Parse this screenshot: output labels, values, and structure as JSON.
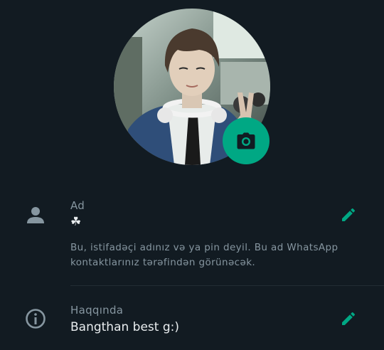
{
  "profile_photo": {
    "alt": "profile photo",
    "camera_icon": "camera-icon"
  },
  "name_section": {
    "icon": "person-icon",
    "label": "Ad",
    "value": "☘︎",
    "edit_icon": "pencil-icon",
    "hint": "Bu, istifadəçi adınız və ya pin deyil. Bu ad WhatsApp kontaktlarınız tərəfindən görünəcək."
  },
  "about_section": {
    "icon": "info-icon",
    "label": "Haqqında",
    "value": "Bangthan best g:)",
    "edit_icon": "pencil-icon"
  },
  "colors": {
    "background": "#121b22",
    "accent": "#00a884",
    "icon": "#8696a0",
    "text_primary": "#e9edef",
    "text_secondary": "#8696a0"
  }
}
